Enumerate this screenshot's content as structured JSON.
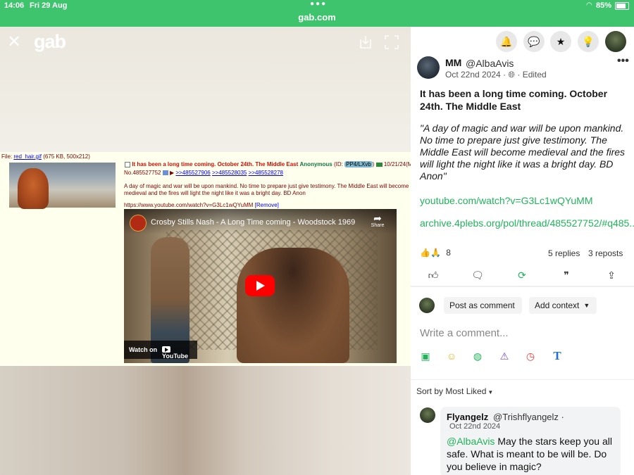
{
  "status_bar": {
    "time": "14:06",
    "date": "Fri 29 Aug",
    "url": "gab.com",
    "battery": "85%"
  },
  "viewer": {
    "logo": "gab",
    "close_icon": "close-icon",
    "download_icon": "download-icon",
    "fullscreen_icon": "fullscreen-icon"
  },
  "chan_post": {
    "file_label": "File:",
    "file_name": "red_hair.gif",
    "file_meta": "(675 KB, 500x212)",
    "subject": "It has been a long time coming. October 24th. The Middle East",
    "name": "Anonymous",
    "id_prefix": "(ID:",
    "poster_id": "PP4/LXvb",
    "id_suffix": ")",
    "datetime": "10/21/24(M",
    "post_no": "No.485527752",
    "arrow": "▶",
    "refs": [
      ">>485527906",
      ">>485528035",
      ">>485528278"
    ],
    "body": "A day of magic and war will be upon mankind. No time to prepare just give testimony. The Middle East will become medieval and the fires will light the night like it was a bright day. BD Anon",
    "yt_url": "https://www.youtube.com/watch?v=G3Lc1wQYuMM",
    "remove": "[Remove]",
    "video_title": "Crosby Stills Nash - A Long Time coming - Woodstock 1969",
    "share_label": "Share",
    "watch_on": "Watch on",
    "youtube": "YouTube"
  },
  "panel": {
    "top_icons": [
      "bell-icon",
      "chat-icon",
      "star-icon",
      "lightbulb-icon"
    ],
    "author_name": "MM",
    "author_handle": "@AlbaAvis",
    "post_date": "Oct 22nd 2024",
    "post_meta_sep": "·",
    "edited": "· Edited",
    "more": "•••",
    "title": "It has been a long time coming. October 24th. The Middle East",
    "quote": "\"A day of magic and war will be upon mankind. No time to prepare just give testimony. The Middle East will become medieval and the fires will light the night like it was a bright day. BD Anon\"",
    "link1": "youtube.com/watch?v=G3Lc1wQYuMM",
    "link2": "archive.4plebs.org/pol/thread/485527752/#q485...",
    "reaction_count": "8",
    "replies": "5 replies",
    "reposts": "3 reposts",
    "actions": [
      "like-icon",
      "comment-icon",
      "repost-icon",
      "quote-icon",
      "share-icon"
    ],
    "post_as_comment": "Post as comment",
    "add_context": "Add context",
    "comment_placeholder": "Write a comment...",
    "composer_tools": [
      "image-icon",
      "emoji-icon",
      "globe-icon",
      "warning-icon",
      "timer-icon",
      "text-icon"
    ],
    "sort_by": "Sort by Most Liked",
    "reply": {
      "name": "Flyangelz",
      "handle": "@Trishflyangelz ·",
      "date": "Oct 22nd 2024",
      "mention": "@AlbaAvis",
      "text": " May the stars keep you all safe. What is meant to be will be. Do you believe in magic?"
    }
  },
  "colors": {
    "accent_green": "#21b35a",
    "status_bar_green": "#3ec46d"
  }
}
